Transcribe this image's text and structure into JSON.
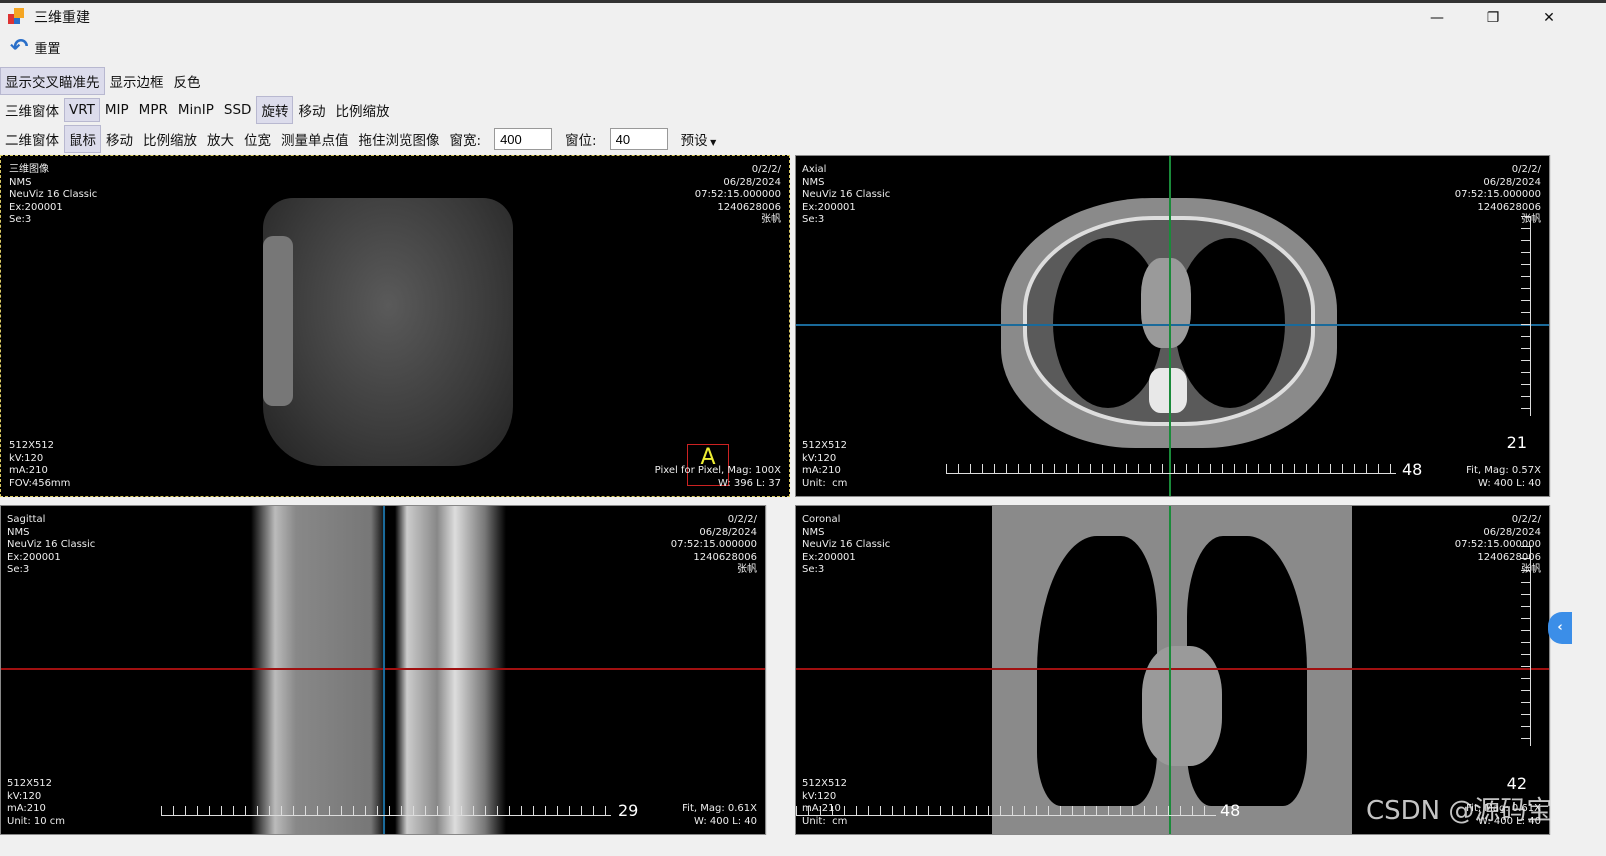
{
  "window": {
    "title": "三维重建",
    "minimize_icon": "minimize-icon",
    "maximize_icon": "restore-icon",
    "close_icon": "close-icon"
  },
  "toolbar": {
    "reset_label": "重置"
  },
  "row1": [
    "显示交叉瞄准先",
    "显示边框",
    "反色"
  ],
  "row2": [
    "三维窗体",
    "VRT",
    "MIP",
    "MPR",
    "MinIP",
    "SSD",
    "旋转",
    "移动",
    "比例缩放"
  ],
  "row3": {
    "items": [
      "二维窗体",
      "鼠标",
      "移动",
      "比例缩放",
      "放大",
      "位宽",
      "测量单点值",
      "拖住浏览图像"
    ],
    "window_width_label": "窗宽:",
    "window_width_value": "400",
    "window_level_label": "窗位:",
    "window_level_value": "40",
    "preset_label": "预设"
  },
  "views": {
    "vrt": {
      "tl": "三维图像\nNMS\nNeuViz 16 Classic\nEx:200001\nSe:3",
      "tr": "0/2/2/\n06/28/2024\n07:52:15.000000\n1240628006\n张帆",
      "bl": "512X512\nkV:120\nmA:210\nFOV:456mm",
      "br": "Pixel for Pixel, Mag: 100X\nW: 396 L: 37"
    },
    "axial": {
      "tl": "Axial\nNMS\nNeuViz 16 Classic\nEx:200001\nSe:3",
      "tr": "0/2/2/\n06/28/2024\n07:52:15.000000\n1240628006\n张帆",
      "bl": "512X512\nkV:120\nmA:210\nUnit:  cm",
      "br": "Fit, Mag: 0.57X\nW: 400 L: 40",
      "slice": "21",
      "ruler": "48"
    },
    "sagittal": {
      "tl": "Sagittal\nNMS\nNeuViz 16 Classic\nEx:200001\nSe:3",
      "tr": "0/2/2/\n06/28/2024\n07:52:15.000000\n1240628006\n张帆",
      "bl": "512X512\nkV:120\nmA:210\nUnit: 10 cm",
      "br": "Fit, Mag: 0.61X\nW: 400 L: 40",
      "ruler": "29"
    },
    "coronal": {
      "tl": "Coronal\nNMS\nNeuViz 16 Classic\nEx:200001\nSe:3",
      "tr": "0/2/2/\n06/28/2024\n07:52:15.000000\n1240628006\n张帆",
      "bl": "512X512\nkV:120\nmA:210\nUnit:  cm",
      "br": "Fit, Mag: 0.61X\nW: 400 L: 40",
      "slice": "42",
      "ruler": "48"
    }
  },
  "watermark": "CSDN @源码宝",
  "colors": {
    "crosshair_blue": "#1a6a9a",
    "crosshair_red": "#a01010",
    "crosshair_green": "#1a8a3a"
  }
}
